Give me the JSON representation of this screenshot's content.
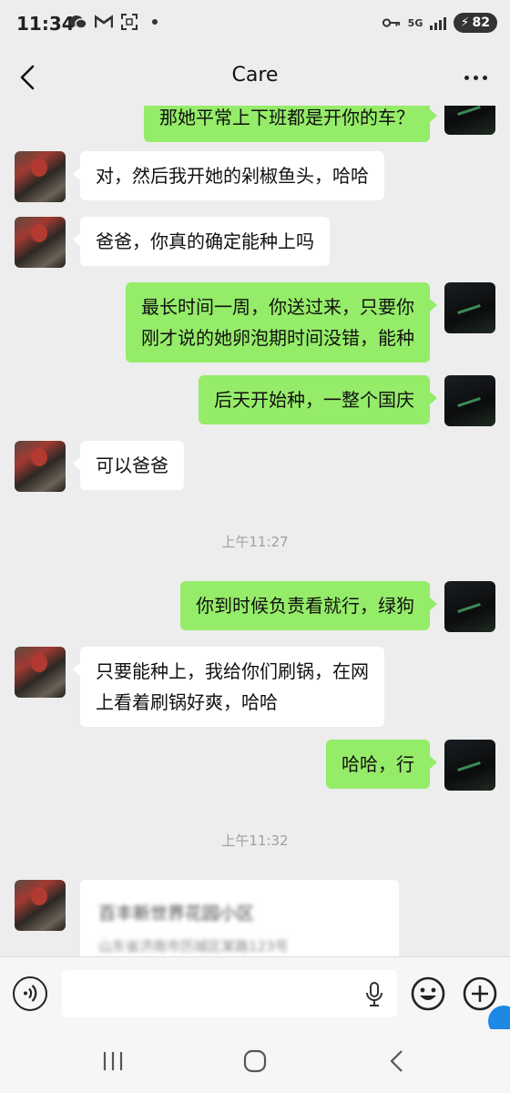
{
  "status_bar": {
    "time": "11:34",
    "battery": "82",
    "network": "5G"
  },
  "nav": {
    "title": "Care"
  },
  "messages": [
    {
      "side": "right",
      "text": "那她平常上下班都是开你的车？"
    },
    {
      "side": "left",
      "text": "对，然后我开她的剁椒鱼头，哈哈"
    },
    {
      "side": "left",
      "text": "爸爸，你真的确定能种上吗"
    },
    {
      "side": "right",
      "lines": [
        "最长时间一周，你送过来，只要你",
        "刚才说的她卵泡期时间没错，能种"
      ]
    },
    {
      "side": "right",
      "text": "后天开始种，一整个国庆"
    },
    {
      "side": "left",
      "text": "可以爸爸"
    },
    {
      "side": "right",
      "text": "你到时候负责看就行，绿狗"
    },
    {
      "side": "left",
      "lines": [
        "只要能种上，我给你们刷锅，在网",
        "上看着刷锅好爽，哈哈"
      ]
    },
    {
      "side": "right",
      "text": "哈哈，行"
    }
  ],
  "timestamps": [
    "上午11:27",
    "上午11:32"
  ],
  "location_card": {
    "title": "百丰新世界花园小区",
    "subtitle": "山东省济南市历城区某路123号"
  },
  "icons": {
    "back": "chevron-left-icon",
    "more": "more-dots-icon",
    "voice": "voice-icon",
    "mic": "mic-icon",
    "emoji": "emoji-icon",
    "plus": "plus-icon"
  },
  "colors": {
    "my_bubble": "#95ec69",
    "friend_bubble": "#ffffff",
    "background": "#ededed"
  }
}
